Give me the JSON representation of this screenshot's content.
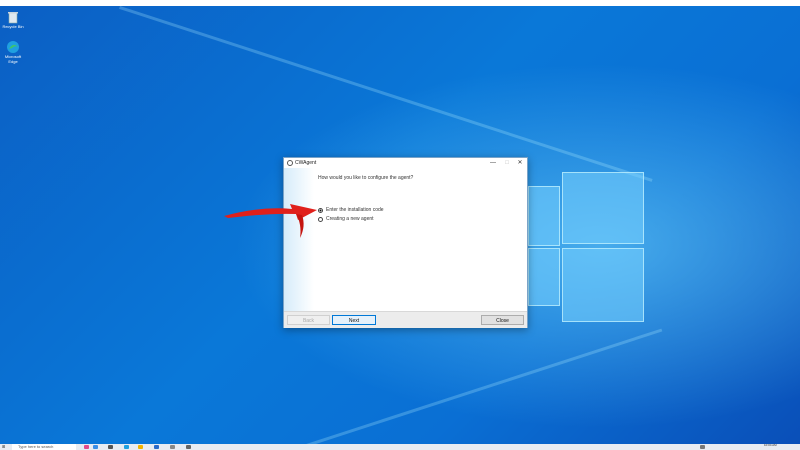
{
  "desktop": {
    "icons": [
      {
        "label": "Recycle Bin",
        "icon": "recycle-bin-icon"
      },
      {
        "label": "Microsoft Edge",
        "icon": "edge-icon"
      }
    ]
  },
  "dialog": {
    "title": "CWAgent",
    "controls": {
      "minimize": "—",
      "maximize": "□",
      "close": "✕"
    },
    "question": "How would you like to configure the agent?",
    "options": [
      {
        "label": "Enter the installation code",
        "checked": true
      },
      {
        "label": "Creating a new agent",
        "checked": false
      }
    ],
    "buttons": {
      "back": "Back",
      "next": "Next",
      "close": "Close"
    }
  },
  "taskbar": {
    "start_glyph": "⊞",
    "search_placeholder": "Type here to search",
    "time": "10:04 AM"
  },
  "colors": {
    "accent": "#0078d7",
    "arrow": "#e0201b",
    "wallpaper": "#0a78d8"
  }
}
